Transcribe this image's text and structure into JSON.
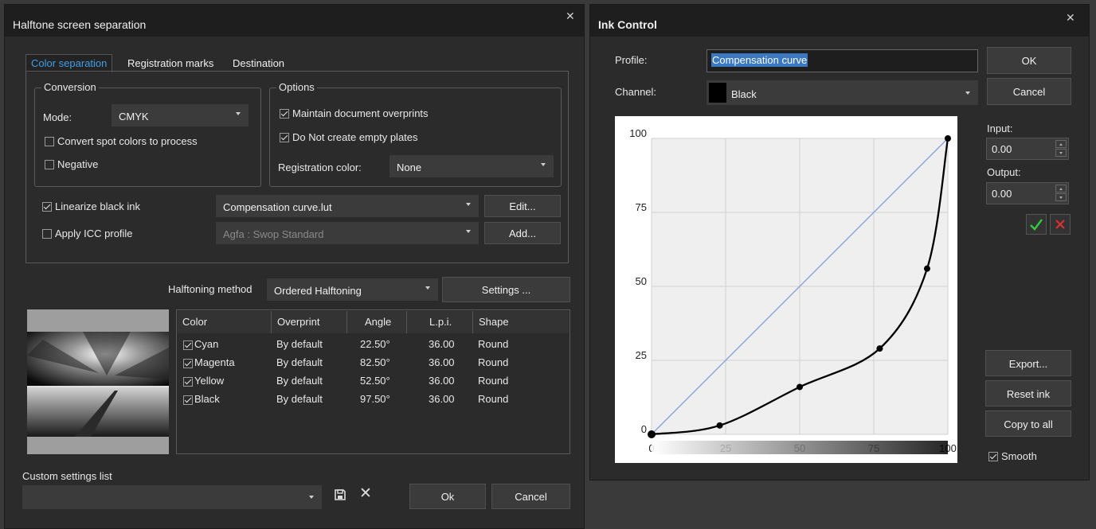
{
  "halftone": {
    "title": "Halftone screen separation",
    "tabs": [
      "Color separation",
      "Registration marks",
      "Destination"
    ],
    "conversion": {
      "legend": "Conversion",
      "mode_label": "Mode:",
      "mode_value": "CMYK",
      "convert_spot": "Convert spot colors to process",
      "negative": "Negative"
    },
    "options": {
      "legend": "Options",
      "maintain_overprints": "Maintain document overprints",
      "no_empty_plates": "Do Not create empty plates",
      "registration_label": "Registration color:",
      "registration_value": "None"
    },
    "linearize": "Linearize black ink",
    "lut_value": "Compensation curve.lut",
    "edit_button": "Edit...",
    "apply_icc": "Apply ICC profile",
    "icc_value": "Agfa : Swop Standard",
    "add_button": "Add...",
    "halftoning_label": "Halftoning method",
    "halftoning_value": "Ordered Halftoning",
    "settings_button": "Settings ...",
    "table": {
      "headers": [
        "Color",
        "Overprint",
        "Angle",
        "L.p.i.",
        "Shape"
      ],
      "rows": [
        [
          "Cyan",
          "By default",
          "22.50°",
          "36.00",
          "Round"
        ],
        [
          "Magenta",
          "By default",
          "82.50°",
          "36.00",
          "Round"
        ],
        [
          "Yellow",
          "By default",
          "52.50°",
          "36.00",
          "Round"
        ],
        [
          "Black",
          "By default",
          "97.50°",
          "36.00",
          "Round"
        ]
      ]
    },
    "custom_settings_label": "Custom settings list",
    "ok_button": "Ok",
    "cancel_button": "Cancel"
  },
  "ink": {
    "title": "Ink Control",
    "profile_label": "Profile:",
    "profile_value": "Compensation curve",
    "channel_label": "Channel:",
    "channel_value": "Black",
    "ok_button": "OK",
    "cancel_button": "Cancel",
    "input_label": "Input:",
    "input_value": "0.00",
    "output_label": "Output:",
    "output_value": "0.00",
    "export_button": "Export...",
    "reset_button": "Reset ink",
    "copy_button": "Copy to all",
    "smooth_label": "Smooth",
    "accent": "#3f9fe8",
    "confirm_color": "#2ecc40",
    "reject_color": "#e03030"
  },
  "chart_data": {
    "type": "line",
    "xlim": [
      0,
      100
    ],
    "ylim": [
      0,
      100
    ],
    "x_ticks": [
      "0",
      "25",
      "50",
      "75",
      "100"
    ],
    "y_ticks": [
      "0",
      "25",
      "50",
      "75",
      "100"
    ],
    "grid": true,
    "series": [
      {
        "x": [
          0,
          100
        ],
        "y": [
          0,
          100
        ],
        "color": "#7f9fe0"
      },
      {
        "x": [
          0,
          23,
          50,
          77,
          93,
          100
        ],
        "y": [
          0,
          3,
          16,
          29,
          56,
          100
        ],
        "color": "#000000",
        "points": true
      }
    ]
  }
}
